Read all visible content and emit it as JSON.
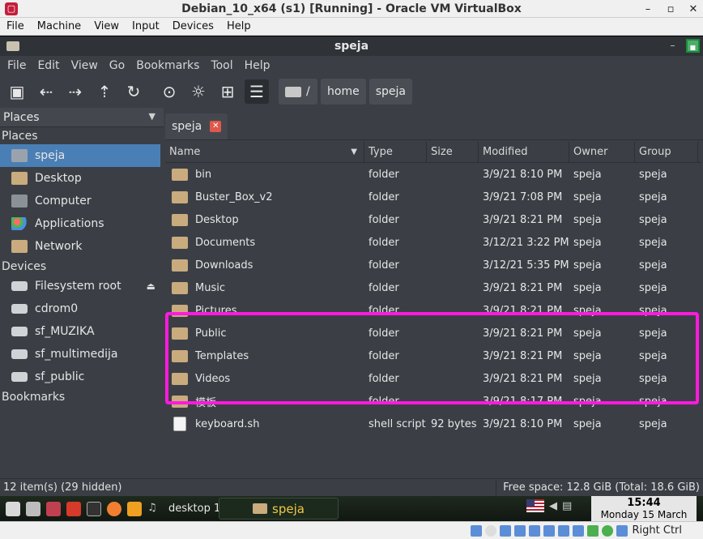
{
  "vbox": {
    "title": "Debian_10_x64 (s1) [Running] - Oracle VM VirtualBox",
    "menu": [
      "File",
      "Machine",
      "View",
      "Input",
      "Devices",
      "Help"
    ],
    "host_key": "Right Ctrl"
  },
  "fm": {
    "title": "speja",
    "menu": [
      "File",
      "Edit",
      "View",
      "Go",
      "Bookmarks",
      "Tool",
      "Help"
    ],
    "breadcrumb": [
      "/",
      "home",
      "speja"
    ],
    "tab_label": "speja",
    "sidebar_mode": "Places"
  },
  "sidebar": {
    "places_heading": "Places",
    "places": [
      {
        "label": "speja",
        "icon": "home-folder-icon"
      },
      {
        "label": "Desktop",
        "icon": "desktop-folder-icon"
      },
      {
        "label": "Computer",
        "icon": "computer-icon"
      },
      {
        "label": "Applications",
        "icon": "applications-icon"
      },
      {
        "label": "Network",
        "icon": "network-folder-icon"
      }
    ],
    "devices_heading": "Devices",
    "devices": [
      {
        "label": "Filesystem root"
      },
      {
        "label": "cdrom0"
      },
      {
        "label": "sf_MUZIKA"
      },
      {
        "label": "sf_multimedija"
      },
      {
        "label": "sf_public"
      }
    ],
    "bookmarks_heading": "Bookmarks"
  },
  "columns": {
    "name": "Name",
    "type": "Type",
    "size": "Size",
    "modified": "Modified",
    "owner": "Owner",
    "group": "Group"
  },
  "files": [
    {
      "name": "bin",
      "type": "folder",
      "size": "",
      "modified": "3/9/21 8:10 PM",
      "owner": "speja",
      "group": "speja"
    },
    {
      "name": "Buster_Box_v2",
      "type": "folder",
      "size": "",
      "modified": "3/9/21 7:08 PM",
      "owner": "speja",
      "group": "speja"
    },
    {
      "name": "Desktop",
      "type": "folder",
      "size": "",
      "modified": "3/9/21 8:21 PM",
      "owner": "speja",
      "group": "speja"
    },
    {
      "name": "Documents",
      "type": "folder",
      "size": "",
      "modified": "3/12/21 3:22 PM",
      "owner": "speja",
      "group": "speja"
    },
    {
      "name": "Downloads",
      "type": "folder",
      "size": "",
      "modified": "3/12/21 5:35 PM",
      "owner": "speja",
      "group": "speja"
    },
    {
      "name": "Music",
      "type": "folder",
      "size": "",
      "modified": "3/9/21 8:21 PM",
      "owner": "speja",
      "group": "speja"
    },
    {
      "name": "Pictures",
      "type": "folder",
      "size": "",
      "modified": "3/9/21 8:21 PM",
      "owner": "speja",
      "group": "speja"
    },
    {
      "name": "Public",
      "type": "folder",
      "size": "",
      "modified": "3/9/21 8:21 PM",
      "owner": "speja",
      "group": "speja"
    },
    {
      "name": "Templates",
      "type": "folder",
      "size": "",
      "modified": "3/9/21 8:21 PM",
      "owner": "speja",
      "group": "speja"
    },
    {
      "name": "Videos",
      "type": "folder",
      "size": "",
      "modified": "3/9/21 8:21 PM",
      "owner": "speja",
      "group": "speja"
    },
    {
      "name": "模板",
      "type": "folder",
      "size": "",
      "modified": "3/9/21 8:17 PM",
      "owner": "speja",
      "group": "speja"
    },
    {
      "name": "keyboard.sh",
      "type": "shell script",
      "size": "92 bytes",
      "modified": "3/9/21 8:10 PM",
      "owner": "speja",
      "group": "speja"
    }
  ],
  "status": {
    "items": "12 item(s) (29 hidden)",
    "free": "Free space: 12.8 GiB (Total: 18.6 GiB)"
  },
  "taskbar": {
    "desktop_label": "desktop 1",
    "task_label": "speja",
    "time": "15:44",
    "date": "Monday 15 March"
  },
  "colors": {
    "highlight": "#ff1adf",
    "selection": "#4a7fb5",
    "background": "#3b3f45"
  }
}
